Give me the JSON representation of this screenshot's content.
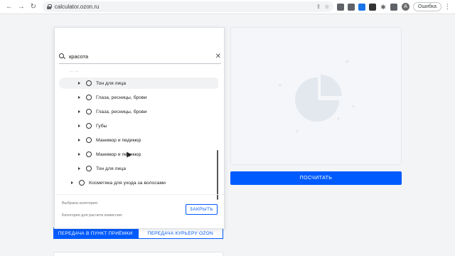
{
  "browser": {
    "url": "calculator.ozon.ru",
    "avatar_letter": "A",
    "error_pill": "Ошибка"
  },
  "background": {
    "calculate_button": "ПОСЧИТАТЬ",
    "tabs": [
      {
        "label": "ПЕРЕДАЧА В ПУНКТ ПРИЁМКИ",
        "active": true
      },
      {
        "label": "ПЕРЕДАЧА КУРЬЕРУ OZON",
        "active": false
      }
    ],
    "accent_color": "#005bff"
  },
  "modal": {
    "search": {
      "value": "красота"
    },
    "faded_row": "— —",
    "tree_items": [
      {
        "label": "Тон для лица",
        "highlighted": true,
        "level": 2
      },
      {
        "label": "Глаза, ресницы, брови",
        "highlighted": false,
        "level": 2
      },
      {
        "label": "Глаза, ресницы, брови",
        "highlighted": false,
        "level": 2
      },
      {
        "label": "Губы",
        "highlighted": false,
        "level": 2
      },
      {
        "label": "Маникюр и педикюр",
        "highlighted": false,
        "level": 2
      },
      {
        "label": "Маникюр и педикюр",
        "highlighted": false,
        "level": 2
      },
      {
        "label": "Тон для лица",
        "highlighted": false,
        "level": 2
      },
      {
        "label": "Косметика для ухода за волосами",
        "highlighted": false,
        "level": 1
      }
    ],
    "selected_category_label": "Выбрана категория:",
    "commission_label": "Категория для расчета комиссии:",
    "close_button": "ЗАКРЫТЬ"
  }
}
